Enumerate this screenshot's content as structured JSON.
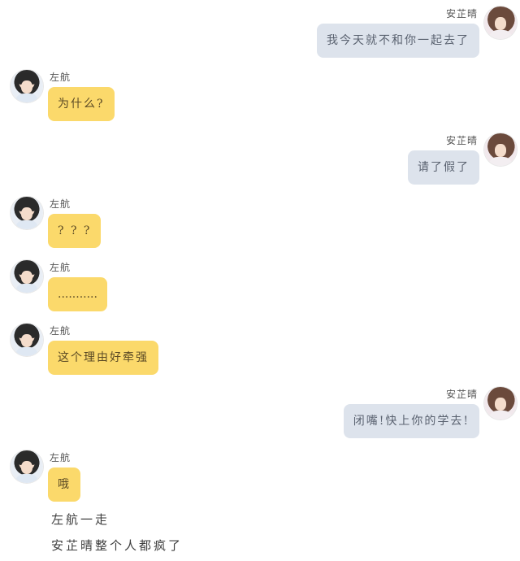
{
  "names": {
    "self": "安芷晴",
    "other": "左航"
  },
  "messages": [
    {
      "side": "right",
      "text": "我今天就不和你一起去了"
    },
    {
      "side": "left",
      "text": "为什么?"
    },
    {
      "side": "right",
      "text": "请了假了"
    },
    {
      "side": "left",
      "text": "? ? ?"
    },
    {
      "side": "left",
      "text": "..........."
    },
    {
      "side": "left",
      "text": "这个理由好牵强"
    },
    {
      "side": "right",
      "text": "闭嘴!快上你的学去!"
    },
    {
      "side": "left",
      "text": "哦"
    }
  ],
  "captions": [
    "左航一走",
    "安芷晴整个人都疯了"
  ],
  "colors": {
    "self_bubble": "#dde3ec",
    "other_bubble": "#fbd96b"
  }
}
